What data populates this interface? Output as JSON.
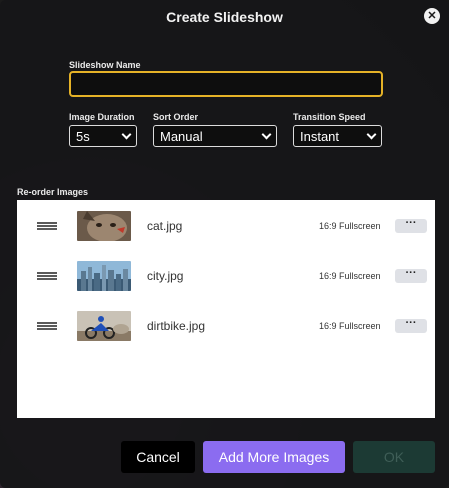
{
  "dialog": {
    "title": "Create Slideshow",
    "close_glyph": "✕"
  },
  "form": {
    "name_label": "Slideshow Name",
    "name_value": "",
    "duration_label": "Image Duration",
    "duration_value": "5s",
    "sort_label": "Sort Order",
    "sort_value": "Manual",
    "speed_label": "Transition Speed",
    "speed_value": "Instant"
  },
  "reorder": {
    "label": "Re-order Images",
    "items": [
      {
        "filename": "cat.jpg",
        "aspect": "16:9 Fullscreen",
        "more": "···",
        "icon": "cat-thumbnail"
      },
      {
        "filename": "city.jpg",
        "aspect": "16:9 Fullscreen",
        "more": "···",
        "icon": "city-thumbnail"
      },
      {
        "filename": "dirtbike.jpg",
        "aspect": "16:9 Fullscreen",
        "more": "···",
        "icon": "dirtbike-thumbnail"
      }
    ]
  },
  "buttons": {
    "cancel": "Cancel",
    "add_more": "Add More Images",
    "ok": "OK"
  },
  "colors": {
    "accent": "#8b6cf0",
    "focus_border": "#e5b227",
    "ok_disabled": "#1c3a34"
  }
}
